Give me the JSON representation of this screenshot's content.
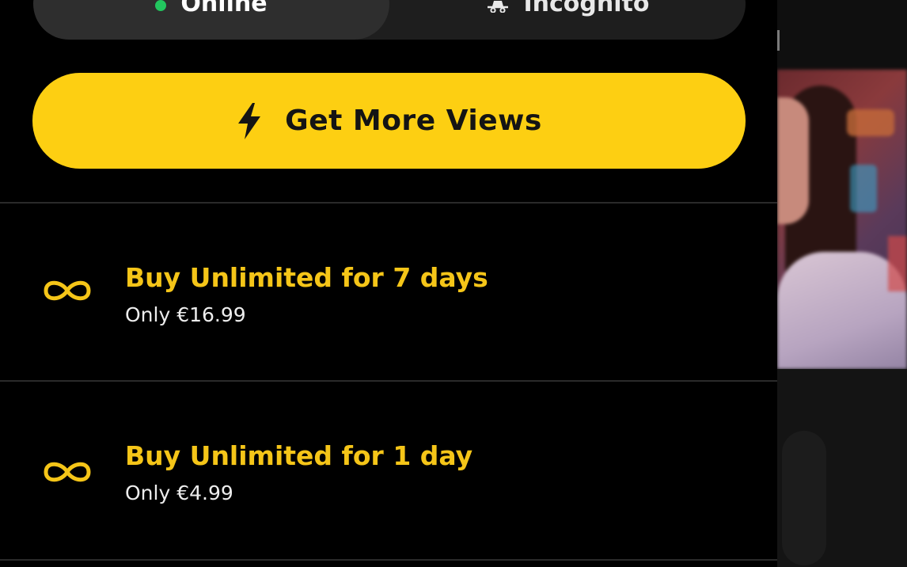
{
  "status_toggle": {
    "online_label": "Online",
    "incognito_label": "Incognito",
    "online_dot_color": "#22c55e",
    "online_icon": "online-dot-icon",
    "incognito_icon": "incognito-icon"
  },
  "get_views": {
    "label": "Get More Views",
    "icon": "lightning-bolt-icon",
    "background_color": "#fdcf12"
  },
  "offers": [
    {
      "icon": "infinity-icon",
      "title": "Buy Unlimited for 7 days",
      "price": "Only €16.99"
    },
    {
      "icon": "infinity-icon",
      "title": "Buy Unlimited for 1 day",
      "price": "Only €4.99"
    }
  ],
  "colors": {
    "accent_yellow": "#f5c518",
    "panel_background": "#000000"
  }
}
